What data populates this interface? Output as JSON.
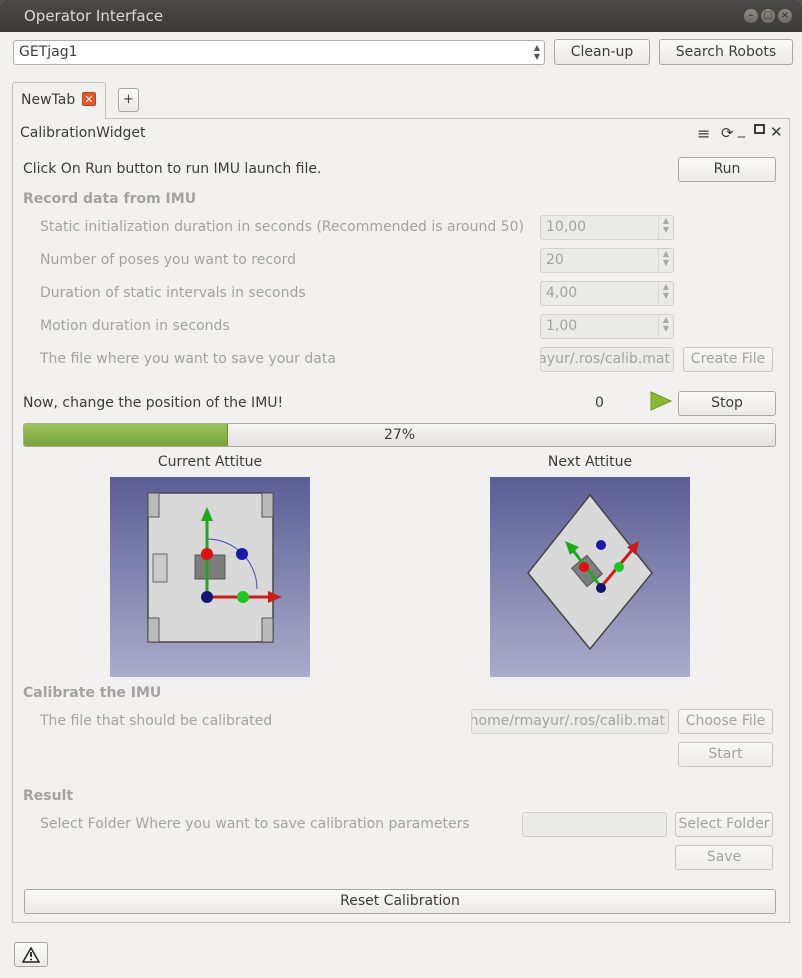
{
  "window": {
    "title": "Operator Interface"
  },
  "toolbar": {
    "robot_select": "GETjag1",
    "cleanup_label": "Clean-up",
    "search_label": "Search Robots"
  },
  "tabs": {
    "active_label": "NewTab",
    "add_label": "+"
  },
  "widget": {
    "title": "CalibrationWidget"
  },
  "run_section": {
    "instruction": "Click On Run button to run IMU launch file.",
    "run_label": "Run"
  },
  "record": {
    "header": "Record data from IMU",
    "static_init_label": "Static initialization duration in seconds (Recommended is around 50)",
    "static_init_value": "10,00",
    "poses_label": "Number of poses you want to record",
    "poses_value": "20",
    "static_interval_label": "Duration of static intervals in seconds",
    "static_interval_value": "4,00",
    "motion_label": "Motion duration in seconds",
    "motion_value": "1,00",
    "file_label": "The file where you want to save your data",
    "file_value": "ayur/.ros/calib.mat",
    "create_file_label": "Create File"
  },
  "position": {
    "instruction": "Now, change the position of the IMU!",
    "counter": "0",
    "stop_label": "Stop"
  },
  "progress": {
    "value": 27,
    "text": "27%"
  },
  "images": {
    "current_label": "Current Attitue",
    "next_label": "Next Attitue"
  },
  "calibrate": {
    "header": "Calibrate the IMU",
    "file_label": "The file that should be calibrated",
    "file_value": "/home/rmayur/.ros/calib.mat",
    "choose_label": "Choose File",
    "start_label": "Start"
  },
  "result": {
    "header": "Result",
    "folder_label": "Select Folder Where you want to save calibration parameters",
    "folder_value": "",
    "select_label": "Select Folder",
    "save_label": "Save"
  },
  "reset_label": "Reset Calibration",
  "colors": {
    "progress_fill": "#8db04e",
    "play_icon": "#8ab936",
    "tab_close": "#e2572b"
  }
}
